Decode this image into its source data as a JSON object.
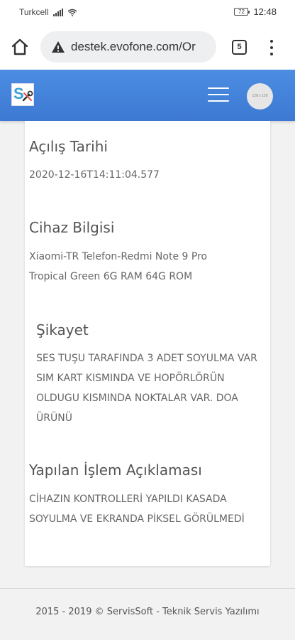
{
  "status_bar": {
    "carrier": "Turkcell",
    "battery": "72",
    "time": "12:48"
  },
  "browser": {
    "url": "destek.evofone.com/Or",
    "tab_count": "5",
    "icons": [
      "home-icon",
      "warning-icon",
      "tabs-icon",
      "more-vert-icon"
    ]
  },
  "app_header": {
    "logo_letter": "S",
    "avatar_text": "128 x 128",
    "accent_color": "#4283db"
  },
  "sections": [
    {
      "title": "Açılış Tarihi",
      "text": "2020-12-16T14:11:04.577"
    },
    {
      "title": "Cihaz Bilgisi",
      "text": "Xiaomi-TR Telefon-Redmi Note 9 Pro Tropical Green 6G RAM 64G ROM"
    },
    {
      "title": "Şikayet",
      "text": "SES TUŞU TARAFINDA 3 ADET SOYULMA VAR SIM KART KISMINDA VE HOPÖRLÖRÜN OLDUGU KISMINDA NOKTALAR VAR. DOA ÜRÜNÜ"
    },
    {
      "title": "Yapılan İşlem Açıklaması",
      "text": "CİHAZIN KONTROLLERİ YAPILDI KASADA SOYULMA VE EKRANDA PİKSEL GÖRÜLMEDİ"
    }
  ],
  "footer": {
    "text": "2015 - 2019 © ServisSoft - Teknik Servis Yazılımı"
  }
}
